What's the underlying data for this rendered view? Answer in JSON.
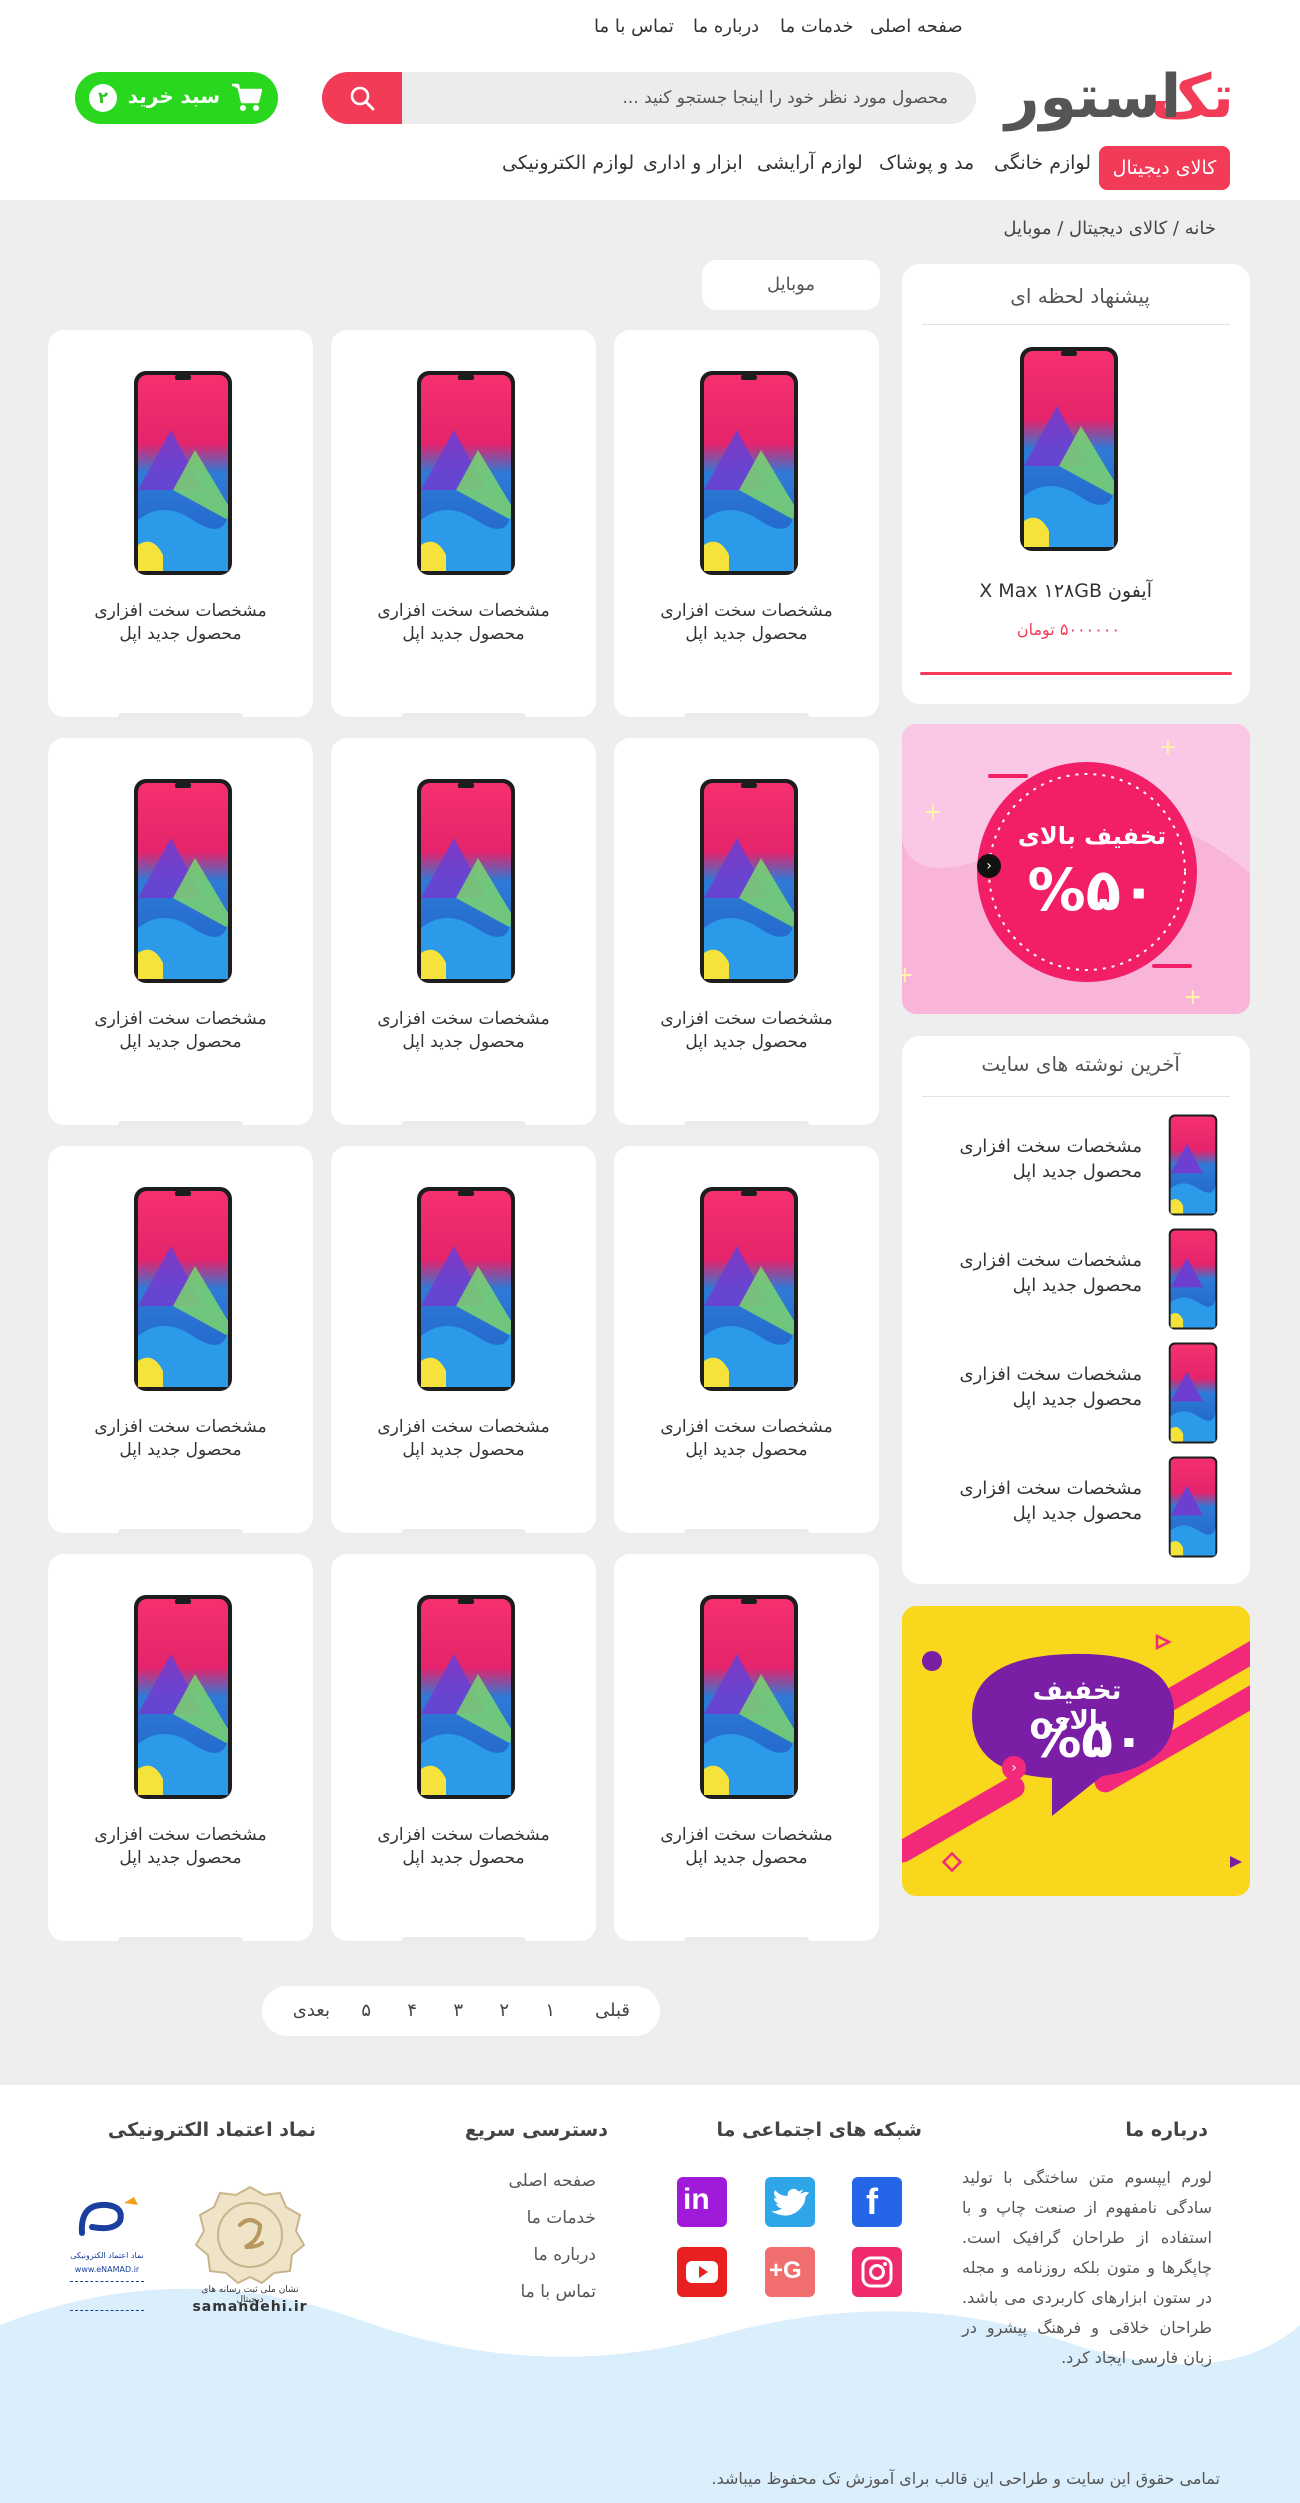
{
  "top_links": [
    "صفحه اصلی",
    "خدمات ما",
    "درباره ما",
    "تماس با ما"
  ],
  "logo": {
    "part1": "تک",
    "part2": "استور",
    "accent": "#f23b57",
    "dark": "#555555"
  },
  "search": {
    "placeholder": "محصول مورد نظر خود را اینجا جستجو کنید ...",
    "icon": "search-icon"
  },
  "cart": {
    "label": "سبد خرید",
    "count": "۲",
    "icon": "shopping-cart-icon"
  },
  "menu": {
    "active": "کالای دیجیتال",
    "items": [
      "لوازم خانگی",
      "مد و پوشاک",
      "لوازم آرایشی",
      "ابزار و اداری",
      "لوازم الکترونیکی"
    ]
  },
  "breadcrumb": "خانه / کالای دیجیتال / موبایل",
  "offer": {
    "title": "پیشنهاد لحظه ای",
    "product": "آیفون X Max ۱۲۸GB",
    "price": "۵۰۰۰۰۰۰ تومان"
  },
  "banner1": {
    "line1": "تخفیف بالای",
    "line2": "%۵۰"
  },
  "posts": {
    "title": "آخرین نوشته های سایت",
    "items": [
      {
        "line1": "مشخصات سخت افزاری",
        "line2": "محصول جدید اپل"
      },
      {
        "line1": "مشخصات سخت افزاری",
        "line2": "محصول جدید اپل"
      },
      {
        "line1": "مشخصات سخت افزاری",
        "line2": "محصول جدید اپل"
      },
      {
        "line1": "مشخصات سخت افزاری",
        "line2": "محصول جدید اپل"
      }
    ]
  },
  "banner2": {
    "line1": "تخفیف بالای",
    "line2": "%۵۰"
  },
  "category_tab": "موبایل",
  "products": [
    {
      "line1": "مشخصات سخت افزاری",
      "line2": "محصول جدید اپل"
    },
    {
      "line1": "مشخصات سخت افزاری",
      "line2": "محصول جدید اپل"
    },
    {
      "line1": "مشخصات سخت افزاری",
      "line2": "محصول جدید اپل"
    },
    {
      "line1": "مشخصات سخت افزاری",
      "line2": "محصول جدید اپل"
    },
    {
      "line1": "مشخصات سخت افزاری",
      "line2": "محصول جدید اپل"
    },
    {
      "line1": "مشخصات سخت افزاری",
      "line2": "محصول جدید اپل"
    },
    {
      "line1": "مشخصات سخت افزاری",
      "line2": "محصول جدید اپل"
    },
    {
      "line1": "مشخصات سخت افزاری",
      "line2": "محصول جدید اپل"
    },
    {
      "line1": "مشخصات سخت افزاری",
      "line2": "محصول جدید اپل"
    },
    {
      "line1": "مشخصات سخت افزاری",
      "line2": "محصول جدید اپل"
    },
    {
      "line1": "مشخصات سخت افزاری",
      "line2": "محصول جدید اپل"
    },
    {
      "line1": "مشخصات سخت افزاری",
      "line2": "محصول جدید اپل"
    }
  ],
  "pagination": {
    "prev": "قبلی",
    "pages": [
      "۱",
      "۲",
      "۳",
      "۴",
      "۵"
    ],
    "next": "بعدی"
  },
  "footer": {
    "about_title": "درباره ما",
    "about_text": "لورم ایپسوم متن ساختگی با تولید سادگی نامفهوم از صنعت چاپ و با استفاده از طراحان گرافیک است. چاپگرها و متون بلکه روزنامه و مجله در ستون ابزارهای کاربردی می باشد. طراحان خلاقی و فرهنگ پیشرو در زبان فارسی ایجاد کرد.",
    "social_title": "شبکه های اجتماعی ما",
    "social": [
      {
        "icon": "facebook-icon",
        "text": "f",
        "color": "#2566e8"
      },
      {
        "icon": "twitter-icon",
        "text": "",
        "color": "#2fa6e8"
      },
      {
        "icon": "linkedin-icon",
        "text": "in",
        "color": "#a01bd9"
      },
      {
        "icon": "instagram-icon",
        "text": "",
        "color": "#f02b6b"
      },
      {
        "icon": "google-plus-icon",
        "text": "G+",
        "color": "#f06e6e"
      },
      {
        "icon": "youtube-icon",
        "text": "",
        "color": "#e82020"
      }
    ],
    "quick_title": "دسترسی سریع",
    "quick_links": [
      "صفحه اصلی",
      "خدمات ما",
      "درباره ما",
      "تماس با ما"
    ],
    "trust_title": "نماد اعتماد الکترونیکی",
    "samandehi": {
      "caption": "samandehi.ir",
      "sub": "نشان ملی ثبت رسانه های دیجیتال"
    },
    "enamad": {
      "caption": "www.eNAMAD.ir",
      "sub": "نماد اعتماد الکترونیکی"
    },
    "copyright": "تمامی حقوق این سایت و طراحی این قالب برای آموزش تک محفوظ میباشد."
  }
}
